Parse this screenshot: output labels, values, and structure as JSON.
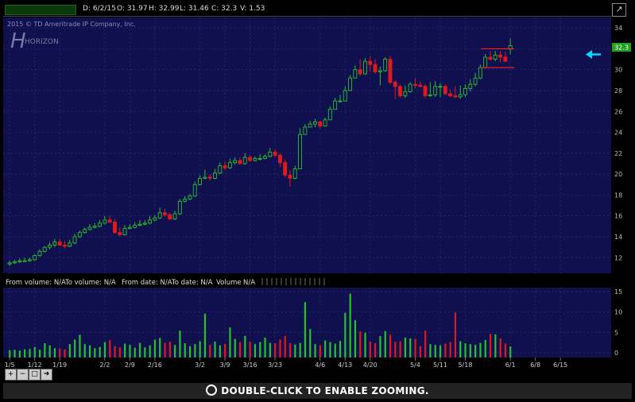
{
  "header": {
    "date": "D: 6/2/15",
    "open": "O: 31.97",
    "high": "H: 32.99",
    "low": "L: 31.46",
    "close": "C: 32.3",
    "volume": "V: 1.53"
  },
  "watermark": {
    "copyright": "2015 © TD Ameritrade IP Company, Inc.",
    "logo_text": "HORIZON"
  },
  "price_badge": "32.3",
  "volume_header": {
    "from_volume": "From volume: N/A",
    "to_volume": "To volume: N/A",
    "from_date": "From date: N/A",
    "to_date": "To date: N/A",
    "volume": "Volume",
    "na": "N/A"
  },
  "toolbar_icons": [
    "zoom-in-icon",
    "zoom-out-icon",
    "zoom-fit-icon",
    "arrow-right-icon"
  ],
  "zoom_hint": "DOUBLE-CLICK TO ENABLE ZOOMING.",
  "colors": {
    "panel_bg": "#10104f",
    "grid": "#2a2a7a",
    "up": "#27c227",
    "down": "#e01a1a",
    "neutral": "#e0e0e0",
    "arrow": "#00d8ff",
    "badge": "#1fa31f",
    "box": "#ff2020"
  },
  "chart_data": [
    {
      "type": "candlestick",
      "y_ticks": [
        12,
        14,
        16,
        18,
        20,
        22,
        24,
        26,
        28,
        30,
        32,
        34
      ],
      "ylim": [
        10.5,
        35
      ],
      "x_labels": [
        "1/5",
        "1/12",
        "1/19",
        "2/2",
        "2/9",
        "2/16",
        "3/2",
        "3/9",
        "3/16",
        "3/23",
        "4/6",
        "4/13",
        "4/20",
        "5/4",
        "5/11",
        "5/18",
        "6/1",
        "6/8",
        "6/15"
      ],
      "x_label_index": [
        0,
        5,
        10,
        19,
        24,
        29,
        38,
        43,
        48,
        53,
        62,
        67,
        72,
        81,
        86,
        91,
        100,
        105,
        110
      ],
      "n_slots": 111,
      "last_close": 32.3,
      "candles": {
        "open": [
          11.4,
          11.5,
          11.6,
          11.7,
          11.7,
          11.8,
          12.2,
          12.6,
          13.0,
          13.2,
          13.5,
          13.2,
          13.1,
          13.4,
          14.0,
          14.4,
          14.7,
          14.9,
          15.0,
          15.3,
          15.6,
          15.4,
          14.4,
          14.2,
          14.8,
          14.9,
          15.1,
          15.2,
          15.3,
          15.6,
          15.8,
          16.3,
          16.1,
          15.7,
          16.2,
          17.4,
          17.6,
          17.9,
          19.0,
          19.6,
          19.7,
          19.6,
          20.1,
          20.8,
          20.6,
          21.1,
          21.3,
          21.0,
          21.6,
          21.3,
          21.5,
          21.5,
          21.7,
          22.1,
          21.8,
          21.1,
          19.9,
          19.6,
          20.5,
          23.8,
          24.5,
          24.8,
          25.0,
          24.6,
          25.2,
          26.2,
          27.0,
          27.0,
          28.0,
          29.2,
          30.0,
          29.6,
          30.8,
          30.5,
          29.8,
          29.9,
          31.0,
          28.8,
          28.4,
          27.5,
          27.9,
          28.6,
          28.5,
          28.4,
          27.5,
          27.6,
          28.4,
          28.4,
          27.7,
          27.5,
          27.4,
          27.6,
          28.2,
          28.6,
          29.2,
          30.2,
          31.2,
          31.0,
          31.4,
          31.2,
          31.97
        ],
        "high": [
          11.7,
          11.8,
          11.9,
          12.0,
          12.0,
          12.3,
          12.8,
          13.1,
          13.5,
          13.8,
          13.8,
          13.6,
          13.7,
          14.3,
          14.6,
          14.9,
          15.2,
          15.3,
          15.6,
          16.0,
          16.0,
          15.7,
          14.9,
          15.1,
          15.2,
          15.4,
          15.6,
          15.6,
          16.0,
          16.1,
          16.8,
          16.7,
          16.3,
          16.5,
          17.6,
          17.9,
          18.1,
          19.3,
          19.9,
          20.4,
          20.0,
          20.5,
          21.1,
          21.2,
          21.5,
          21.6,
          21.6,
          22.0,
          21.8,
          21.7,
          21.9,
          21.9,
          22.5,
          22.4,
          22.0,
          21.4,
          20.4,
          20.8,
          24.4,
          24.8,
          25.1,
          25.3,
          25.1,
          25.4,
          26.5,
          27.3,
          27.6,
          28.4,
          29.5,
          30.4,
          31.0,
          31.1,
          31.3,
          31.0,
          30.3,
          31.2,
          31.3,
          29.0,
          28.6,
          28.5,
          28.8,
          29.2,
          28.9,
          28.6,
          28.8,
          28.9,
          28.7,
          28.6,
          28.1,
          28.4,
          28.5,
          28.6,
          29.1,
          29.7,
          30.5,
          31.5,
          31.8,
          31.8,
          31.8,
          31.7,
          32.99
        ],
        "low": [
          11.2,
          11.4,
          11.5,
          11.6,
          11.6,
          11.7,
          12.1,
          12.5,
          12.8,
          13.0,
          13.1,
          12.9,
          13.0,
          13.3,
          13.9,
          14.3,
          14.6,
          14.8,
          14.9,
          15.2,
          15.3,
          14.3,
          14.0,
          14.1,
          14.7,
          14.8,
          15.0,
          15.1,
          15.2,
          15.5,
          15.7,
          15.9,
          15.6,
          15.6,
          16.1,
          17.3,
          17.5,
          17.8,
          18.9,
          19.5,
          19.4,
          19.5,
          20.0,
          20.4,
          20.5,
          20.9,
          20.9,
          20.9,
          21.2,
          21.2,
          21.3,
          21.4,
          21.6,
          21.6,
          20.7,
          19.7,
          18.8,
          19.5,
          23.5,
          24.4,
          24.6,
          24.5,
          24.4,
          25.1,
          26.1,
          26.9,
          26.9,
          27.9,
          28.9,
          29.9,
          29.4,
          29.5,
          29.8,
          29.6,
          28.5,
          29.8,
          28.6,
          27.2,
          27.3,
          27.3,
          27.8,
          28.2,
          28.3,
          27.3,
          27.4,
          27.4,
          27.4,
          27.6,
          27.4,
          27.3,
          27.2,
          27.4,
          27.9,
          28.4,
          29.1,
          30.1,
          30.9,
          30.8,
          30.7,
          31.0,
          31.46
        ],
        "close": [
          11.5,
          11.6,
          11.7,
          11.7,
          11.8,
          12.2,
          12.6,
          13.0,
          13.2,
          13.5,
          13.2,
          13.1,
          13.4,
          14.0,
          14.4,
          14.7,
          14.9,
          15.0,
          15.3,
          15.6,
          15.4,
          14.4,
          14.2,
          14.8,
          14.9,
          15.1,
          15.2,
          15.3,
          15.6,
          15.8,
          16.3,
          16.1,
          15.7,
          16.2,
          17.4,
          17.6,
          17.9,
          19.0,
          19.6,
          19.7,
          19.6,
          20.1,
          20.8,
          20.6,
          21.1,
          21.3,
          21.0,
          21.6,
          21.3,
          21.5,
          21.5,
          21.7,
          22.1,
          21.8,
          21.1,
          19.9,
          19.6,
          20.5,
          23.8,
          24.5,
          24.8,
          25.0,
          24.6,
          25.2,
          26.2,
          27.0,
          27.0,
          28.0,
          29.2,
          30.0,
          29.6,
          30.8,
          30.5,
          29.8,
          29.9,
          31.0,
          28.8,
          28.4,
          27.5,
          27.9,
          28.6,
          28.5,
          28.4,
          27.5,
          27.6,
          28.4,
          28.4,
          27.7,
          27.5,
          27.4,
          27.6,
          28.2,
          28.6,
          29.2,
          30.2,
          31.2,
          31.0,
          31.4,
          31.2,
          30.8,
          32.3
        ]
      },
      "annotations": {
        "range_box": {
          "from_index": 95,
          "to_index": 100,
          "upper": 32.0,
          "lower": 30.2
        }
      }
    },
    {
      "type": "bar",
      "title": "Volume",
      "y_ticks": [
        0,
        5,
        10,
        15
      ],
      "ylim": [
        -1.2,
        16
      ],
      "values": [
        0.6,
        0.7,
        0.5,
        0.8,
        0.9,
        1.4,
        0.7,
        2.3,
        1.8,
        1.1,
        1.0,
        0.8,
        2.1,
        3.2,
        4.4,
        2.1,
        1.8,
        1.1,
        1.4,
        2.6,
        3.1,
        1.6,
        1.3,
        2.2,
        1.9,
        1.2,
        2.4,
        1.3,
        1.8,
        3.2,
        3.6,
        2.4,
        2.7,
        1.9,
        5.4,
        2.3,
        1.6,
        2.1,
        2.8,
        9.6,
        1.9,
        2.7,
        1.8,
        2.1,
        6.2,
        3.4,
        2.6,
        4.1,
        2.7,
        2.1,
        2.6,
        3.7,
        2.4,
        2.3,
        3.2,
        4.1,
        2.3,
        2.0,
        2.4,
        12.4,
        5.8,
        2.1,
        1.8,
        3.0,
        2.6,
        2.2,
        2.9,
        9.8,
        14.5,
        8.0,
        5.2,
        4.9,
        2.7,
        2.3,
        4.1,
        5.3,
        4.4,
        2.7,
        2.8,
        3.7,
        3.5,
        3.4,
        1.6,
        5.4,
        2.1,
        1.9,
        1.8,
        2.2,
        2.6,
        9.9,
        2.8,
        2.3,
        2.1,
        1.9,
        2.4,
        3.1,
        4.6,
        4.5,
        3.5,
        2.2,
        1.53
      ],
      "colors_up_down": "close"
    }
  ]
}
